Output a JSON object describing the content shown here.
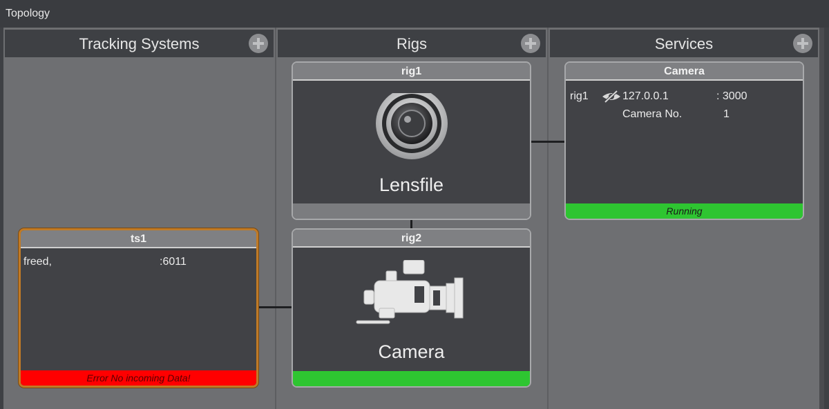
{
  "window": {
    "title": "Topology"
  },
  "columns": {
    "tracking": {
      "header": "Tracking Systems"
    },
    "rigs": {
      "header": "Rigs"
    },
    "services": {
      "header": "Services"
    }
  },
  "tracking_systems": [
    {
      "name": "ts1",
      "protocol": "freed,",
      "port": ":6011",
      "status": "Error No incoming Data!",
      "status_color": "#ff0000"
    }
  ],
  "rigs": [
    {
      "name": "rig1",
      "label": "Lensfile",
      "icon": "lens-icon",
      "status_color": "#7b7c7f"
    },
    {
      "name": "rig2",
      "label": "Camera",
      "icon": "video-camera-icon",
      "status_color": "#2ec531"
    }
  ],
  "services": [
    {
      "name": "Camera",
      "rig": "rig1",
      "icon": "eye-slash-icon",
      "ip": "127.0.0.1",
      "port": ": 3000",
      "field_label": "Camera No.",
      "field_value": "1",
      "status": "Running",
      "status_color": "#2ec531"
    }
  ],
  "colors": {
    "accent_error": "#ff0000",
    "accent_ok": "#2ec531",
    "selected_border": "#c07a26"
  }
}
